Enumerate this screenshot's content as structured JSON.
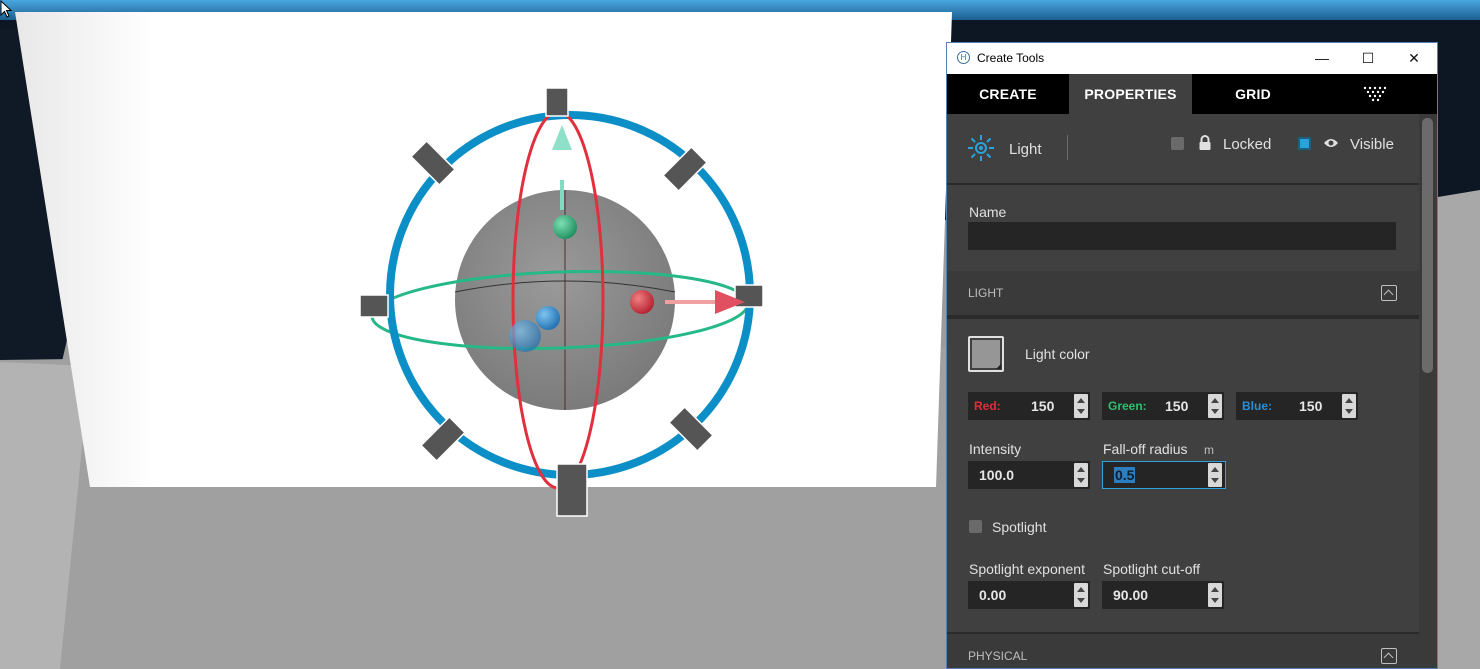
{
  "window": {
    "title": "Create Tools",
    "app_icon_glyph": "H",
    "controls": {
      "minimize": "—",
      "maximize": "☐",
      "close": "✕"
    }
  },
  "tabs": [
    {
      "label": "CREATE",
      "active": false
    },
    {
      "label": "PROPERTIES",
      "active": true
    },
    {
      "label": "GRID",
      "active": false
    }
  ],
  "header": {
    "entity_type": "Light",
    "entity_icon": "sun-icon",
    "locked": {
      "label": "Locked",
      "checked": false,
      "icon": "lock-icon"
    },
    "visible": {
      "label": "Visible",
      "checked": true,
      "icon": "eye-icon"
    }
  },
  "name_field": {
    "label": "Name",
    "value": ""
  },
  "sections": {
    "light": "LIGHT",
    "physical": "PHYSICAL"
  },
  "light": {
    "color_label": "Light color",
    "swatch_color": "#969696",
    "red": {
      "label": "Red:",
      "value": "150",
      "color": "#e0303d"
    },
    "green": {
      "label": "Green:",
      "value": "150",
      "color": "#2fc06e"
    },
    "blue": {
      "label": "Blue:",
      "value": "150",
      "color": "#2a8fd6"
    },
    "intensity": {
      "label": "Intensity",
      "value": "100.0"
    },
    "falloff": {
      "label": "Fall-off radius",
      "unit": "m",
      "value": "0.5"
    },
    "spotlight": {
      "label": "Spotlight",
      "checked": false
    },
    "spot_exponent": {
      "label": "Spotlight exponent",
      "value": "0.00"
    },
    "spot_cutoff": {
      "label": "Spotlight cut-off",
      "value": "90.00"
    }
  },
  "colors": {
    "accent": "#2aa3dd",
    "panel_bg": "#404040",
    "ring_blue": "#0b8fc6",
    "ring_red": "#e0303d",
    "ring_green": "#26b887"
  }
}
